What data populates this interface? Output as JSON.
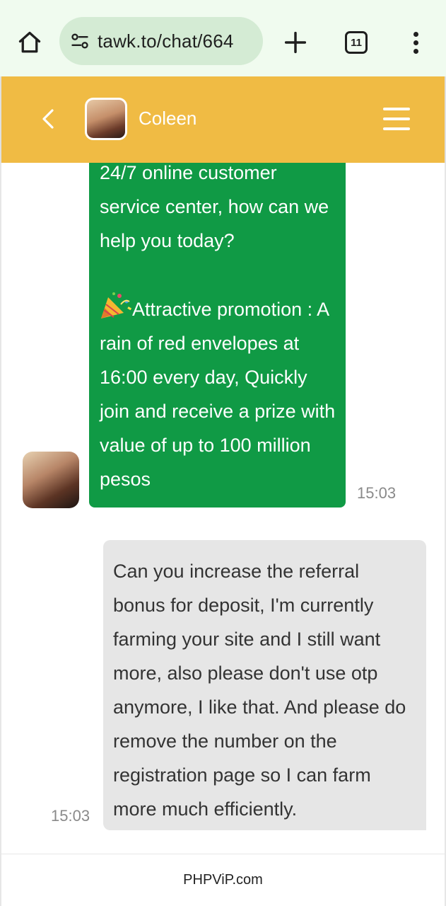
{
  "browser": {
    "url": "tawk.to/chat/664",
    "tab_count": "11"
  },
  "header": {
    "agent_name": "Coleen"
  },
  "messages": {
    "agent": {
      "lines": [
        "24/7 online customer service center, how can we help you today?",
        "Attractive promotion : A rain of red envelopes at 16:00 every day, Quickly join and receive a prize with value of up to 100 million pesos"
      ],
      "time": "15:03"
    },
    "user": {
      "text": "Can you increase the referral bonus for deposit, I'm currently farming your site and I still want more, also please don't use otp anymore, I like that. And please do remove the number on the registration page so I can farm more much efficiently.",
      "time": "15:03"
    }
  },
  "footer": {
    "brand": "PHPViP.com"
  },
  "icons": {
    "home": "home-icon",
    "site_settings": "tune-icon",
    "new_tab": "plus-icon",
    "tabs": "tab-switcher-icon",
    "menu": "more-vert-icon",
    "back": "chevron-left-icon",
    "hamburger": "hamburger-icon",
    "promo": "party-popper-icon"
  },
  "colors": {
    "header": "#f0bb44",
    "agent_bubble": "#109a45",
    "user_bubble": "#e6e6e6",
    "browser_bar": "#f0fbef"
  }
}
